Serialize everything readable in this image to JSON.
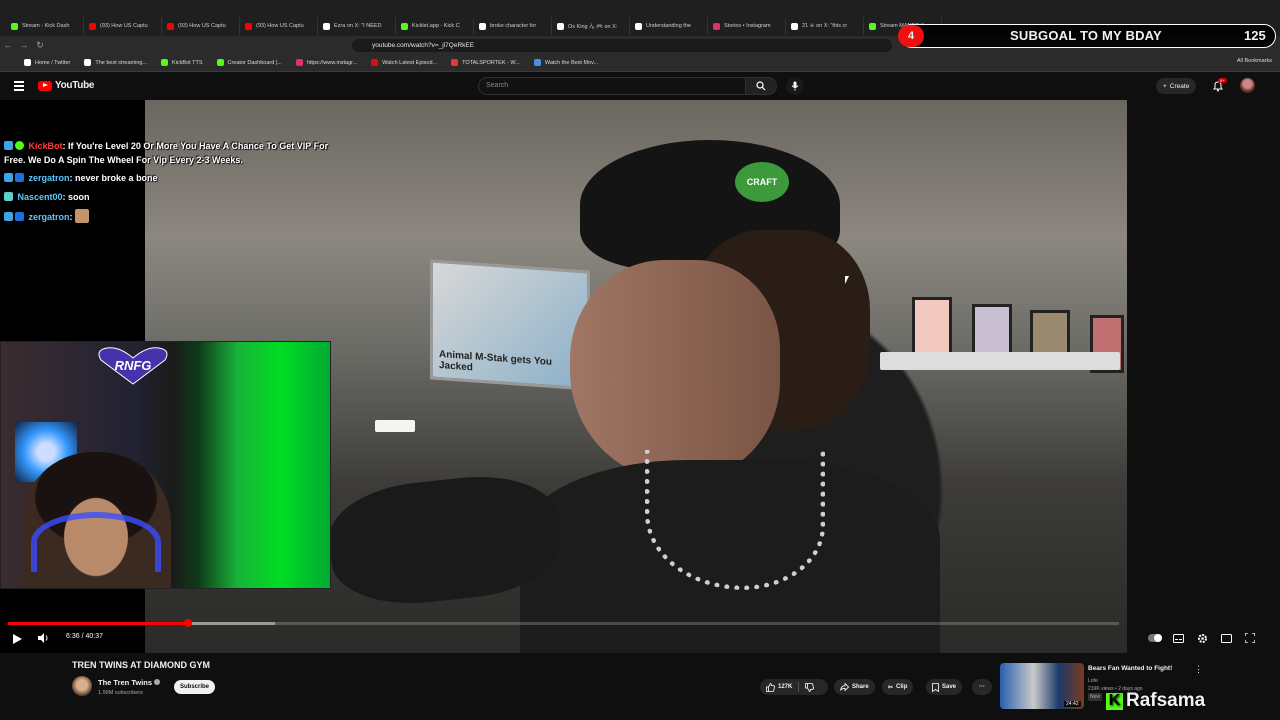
{
  "browser": {
    "tabs": [
      {
        "label": "Stream - Kick Dash",
        "color": "#53fc18"
      },
      {
        "label": "(93) How US Captu",
        "color": "#ff0000"
      },
      {
        "label": "(93) How US Captu",
        "color": "#ff0000"
      },
      {
        "label": "(93) How US Captu",
        "color": "#ff0000"
      },
      {
        "label": "Ezra on X: \"I NEED",
        "color": "#ffffff"
      },
      {
        "label": "Kicklet.app - Kick C",
        "color": "#53fc18"
      },
      {
        "label": "broke character for",
        "color": "#ffffff"
      },
      {
        "label": "Ox King ん 🎮 on X:",
        "color": "#ffffff"
      },
      {
        "label": "Understanding the",
        "color": "#ffffff"
      },
      {
        "label": "Stories • Instagram",
        "color": "#e1306c"
      },
      {
        "label": "21 ☠ on X: \"this cr",
        "color": "#ffffff"
      },
      {
        "label": "Stream MANEO ft",
        "color": "#53fc18"
      }
    ],
    "url": "youtube.com/watch?v=_jl7QeRkEE",
    "bookmarks": [
      {
        "label": "Home / Twitter",
        "color": "#ffffff"
      },
      {
        "label": "The best streaming...",
        "color": "#ffffff"
      },
      {
        "label": "KickBot TTS",
        "color": "#53fc18"
      },
      {
        "label": "Creator Dashboard |...",
        "color": "#53fc18"
      },
      {
        "label": "https://www.instagr...",
        "color": "#e1306c"
      },
      {
        "label": "Watch Latest Episod...",
        "color": "#e50914"
      },
      {
        "label": "TOTALSPORTEK - W...",
        "color": "#e53935"
      },
      {
        "label": "Watch the Best Mov...",
        "color": "#4a90e2"
      }
    ],
    "all_bookmarks": "All Bookmarks"
  },
  "youtube": {
    "logo": "YouTube",
    "search_placeholder": "Search",
    "create": "Create",
    "notif_badge": "9+",
    "video": {
      "time": "6:36 / 40:37",
      "progress": 0.162,
      "buffered": 0.24
    },
    "title": "TREN TWINS AT DIAMOND GYM",
    "channel": {
      "name": "The Tren Twins",
      "subs": "1.99M subscribers",
      "subscribe": "Subscribe"
    },
    "actions": {
      "likes": "127K",
      "share": "Share",
      "clip": "Clip",
      "save": "Save"
    },
    "recommended": {
      "title": "Bears Fan Wanted to Fight!",
      "channel": "Lofe",
      "meta": "219K views • 2 days ago",
      "badge": "New",
      "duration": "24:42"
    }
  },
  "video_scene": {
    "poster_text": "Animal M-Stak gets You Jacked",
    "cap_text": "CRAFT"
  },
  "overlay": {
    "chat": [
      {
        "user": "KickBot",
        "message": "If You're Level 20 Or More You Have A Chance To Get VIP For Free. We Do A Spin The Wheel For Vip Every 2-3 Weeks."
      },
      {
        "user": "zergatron",
        "message": "never broke a bone"
      },
      {
        "user": "Nascent00",
        "message": "soon"
      },
      {
        "user": "zergatron",
        "message": ""
      }
    ],
    "webcam_logo": "RNFG",
    "subgoal_count": "4",
    "subgoal_text": "SUBGOAL TO MY BDAY",
    "subgoal_total": "125",
    "kick_name": "Rafsama"
  }
}
